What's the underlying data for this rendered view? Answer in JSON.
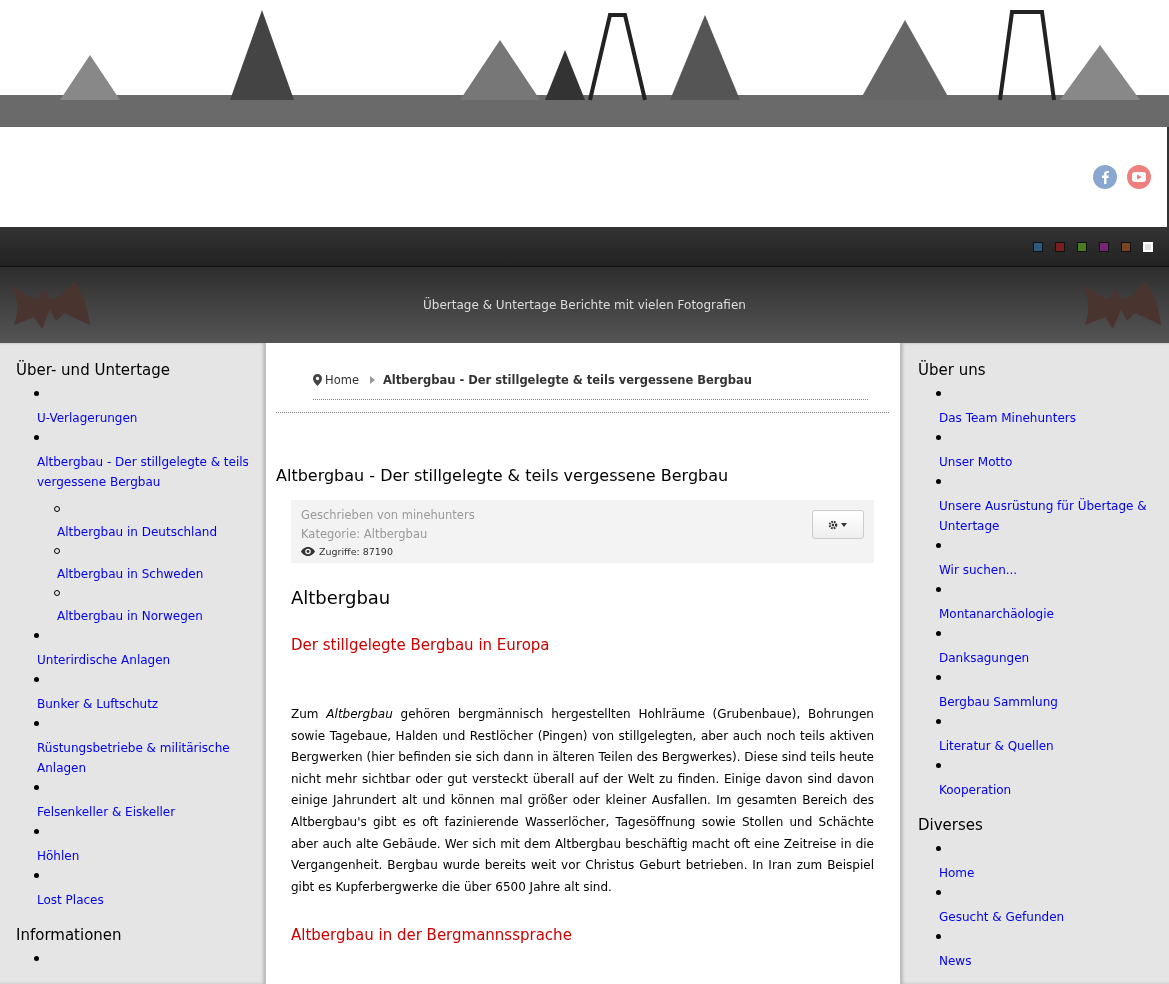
{
  "header": {
    "social": [
      {
        "kind": "facebook"
      },
      {
        "kind": "youtube"
      }
    ]
  },
  "theme_swatches": [
    {
      "color": "#2a5a80",
      "selected": false
    },
    {
      "color": "#7a1f1f",
      "selected": false
    },
    {
      "color": "#4a7a22",
      "selected": false
    },
    {
      "color": "#7a2372",
      "selected": false
    },
    {
      "color": "#7a4422",
      "selected": false
    },
    {
      "color": "#e0e0e0",
      "selected": true
    }
  ],
  "tagline": "Übertage & Untertage Berichte mit vielen Fotografien",
  "left_sidebar": [
    {
      "title": "Über- und Untertage",
      "items": [
        {
          "label": "U-Verlagerungen"
        },
        {
          "label": "Altbergbau - Der stillgelegte & teils vergessene Bergbau",
          "children": [
            {
              "label": "Altbergbau in Deutschland"
            },
            {
              "label": "Altbergbau in Schweden"
            },
            {
              "label": "Altbergbau in Norwegen"
            }
          ]
        },
        {
          "label": "Unterirdische Anlagen"
        },
        {
          "label": "Bunker & Luftschutz"
        },
        {
          "label": "Rüstungsbetriebe & militärische Anlagen"
        },
        {
          "label": "Felsenkeller & Eiskeller"
        },
        {
          "label": "Höhlen"
        },
        {
          "label": "Lost Places"
        }
      ]
    },
    {
      "title": "Informationen",
      "cut_off": true
    }
  ],
  "breadcrumb": [
    {
      "label": "Home"
    },
    {
      "label": "Altbergbau - Der stillgelegte & teils vergessene Bergbau"
    }
  ],
  "article": {
    "title": "Altbergbau - Der stillgelegte & teils vergessene Bergbau",
    "author": "Geschrieben von minehunters",
    "category": "Kategorie: Altbergbau",
    "hits": "Zugriffe: 87190",
    "heading": "Altbergbau",
    "subheading": "Der stillgelegte Bergbau in Europa",
    "paragraph": "Zum *Altbergbau* gehören bergmännisch hergestellten Hohlräume (Grubenbaue), Bohrungen sowie Tagebaue, Halden und Restlöcher (Pingen) von stillgelegten, aber auch noch teils aktiven Bergwerken (hier befinden sie sich dann in älteren Teilen des Bergwerkes). Diese sind teils heute nicht mehr sichtbar oder gut versteckt überall auf der Welt zu finden. Einige davon sind davon einige Jahrundert alt und können mal größer oder kleiner Ausfallen. Im gesamten Bereich des Altbergbau's gibt es oft fazinierende Wasserlöcher, Tagesöffnung sowie Stollen und Schächte aber auch alte Gebäude. Wer sich mit dem Altbergbau beschäftig macht oft eine Zeitreise in die Vergangenheit. Bergbau wurde bereits weit vor Christus Geburt betrieben. In Iran zum Beispiel gibt es  Kupferbergwerke die über 6500 Jahre alt sind.",
    "subheading_2": "Altbergbau in der Bergmannssprache"
  },
  "right_sidebar": [
    {
      "title": "Über uns",
      "items": [
        {
          "label": "Das Team Minehunters"
        },
        {
          "label": "Unser Motto"
        },
        {
          "label": "Unsere Ausrüstung für Übertage & Untertage"
        },
        {
          "label": "Wir suchen..."
        },
        {
          "label": "Montanarchäologie"
        },
        {
          "label": "Danksagungen"
        },
        {
          "label": "Bergbau Sammlung"
        },
        {
          "label": "Literatur & Quellen"
        },
        {
          "label": "Kooperation"
        }
      ]
    },
    {
      "title": "Diverses",
      "items": [
        {
          "label": "Home"
        },
        {
          "label": "Gesucht & Gefunden"
        },
        {
          "label": "News"
        }
      ]
    }
  ]
}
